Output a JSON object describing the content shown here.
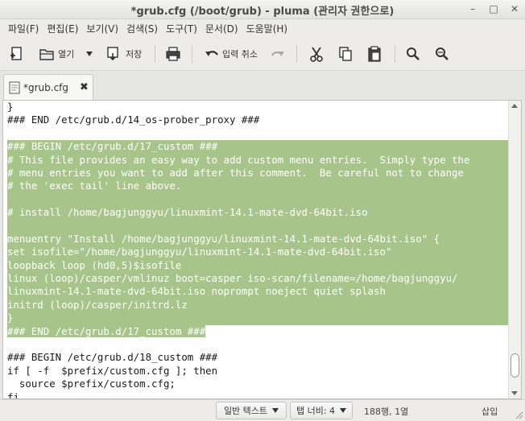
{
  "window": {
    "title": "*grub.cfg (/boot/grub) - pluma (관리자 권한으로)",
    "minimize": "–",
    "maximize": "□",
    "close": "✕"
  },
  "menubar": {
    "items": [
      "파일(F)",
      "편집(E)",
      "보기(V)",
      "검색(S)",
      "도구(T)",
      "문서(D)",
      "도움말(H)"
    ]
  },
  "toolbar": {
    "open_label": "열기",
    "save_label": "저장",
    "undo_label": "입력 취소"
  },
  "tab": {
    "name": "*grub.cfg",
    "close": "✖"
  },
  "editor": {
    "lines": [
      "}",
      "### END /etc/grub.d/14_os-prober_proxy ###",
      "",
      "### BEGIN /etc/grub.d/17_custom ###",
      "# This file provides an easy way to add custom menu entries.  Simply type the",
      "# menu entries you want to add after this comment.  Be careful not to change",
      "# the 'exec tail' line above.",
      "",
      "# install /home/bagjunggyu/linuxmint-14.1-mate-dvd-64bit.iso",
      "",
      "menuentry \"Install /home/bagjunggyu/linuxmint-14.1-mate-dvd-64bit.iso\" {",
      "set isofile=\"/home/bagjunggyu/linuxmint-14.1-mate-dvd-64bit.iso\"",
      "loopback loop (hd0,5)$isofile",
      "linux (loop)/casper/vmlinuz boot=casper iso-scan/filename=/home/bagjunggyu/",
      "linuxmint-14.1-mate-dvd-64bit.iso noprompt noeject quiet splash",
      "initrd (loop)/casper/initrd.lz",
      "}",
      "### END /etc/grub.d/17_custom ###",
      "",
      "### BEGIN /etc/grub.d/18_custom ###",
      "if [ -f  $prefix/custom.cfg ]; then",
      "  source $prefix/custom.cfg;",
      "fi"
    ]
  },
  "statusbar": {
    "language": "일반 텍스트",
    "tab_width": "탭 너비: 4",
    "position": "188행, 1열",
    "mode": "삽입"
  },
  "colors": {
    "selection": "#a7c58a",
    "editor_bg": "#ffffff"
  }
}
